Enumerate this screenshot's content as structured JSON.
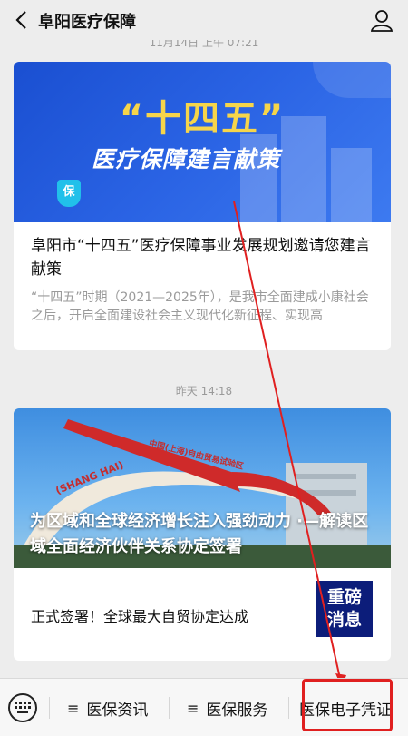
{
  "header": {
    "title": "阜阳医疗保障",
    "back_icon": "chevron-left-icon",
    "profile_icon": "person-icon"
  },
  "feed": {
    "timestamp_top": "11月14日 上午 07:21",
    "article1": {
      "banner_big": "“十四五”",
      "banner_sub": "医疗保障建言献策",
      "banner_badge": "保",
      "title": "阜阳市“十四五”医疗保障事业发展规划邀请您建言献策",
      "desc": "“十四五”时期（2021—2025年），是我市全面建成小康社会之后，开启全面建设社会主义现代化新征程、实现高"
    },
    "timestamp_mid": "昨天 14:18",
    "article2": {
      "arch_text_left": "(SHANG HAI)",
      "arch_text_right": "中国(上海)自由贸易试验区",
      "overlay_title": "为区域和全球经济增长注入强劲动力 ·—解读区域全面经济伙伴关系协定签署",
      "sub_title": "正式签署！全球最大自贸协定达成",
      "thumb_line1": "重磅",
      "thumb_line2": "消息"
    }
  },
  "bottom_menu": {
    "keyboard_icon": "keyboard-icon",
    "item1": "医保资讯",
    "item2": "医保服务",
    "item3": "医保电子凭证"
  },
  "colors": {
    "highlight": "#e02020",
    "banner_blue": "#2a63e4",
    "banner_gold": "#f6d54a"
  }
}
